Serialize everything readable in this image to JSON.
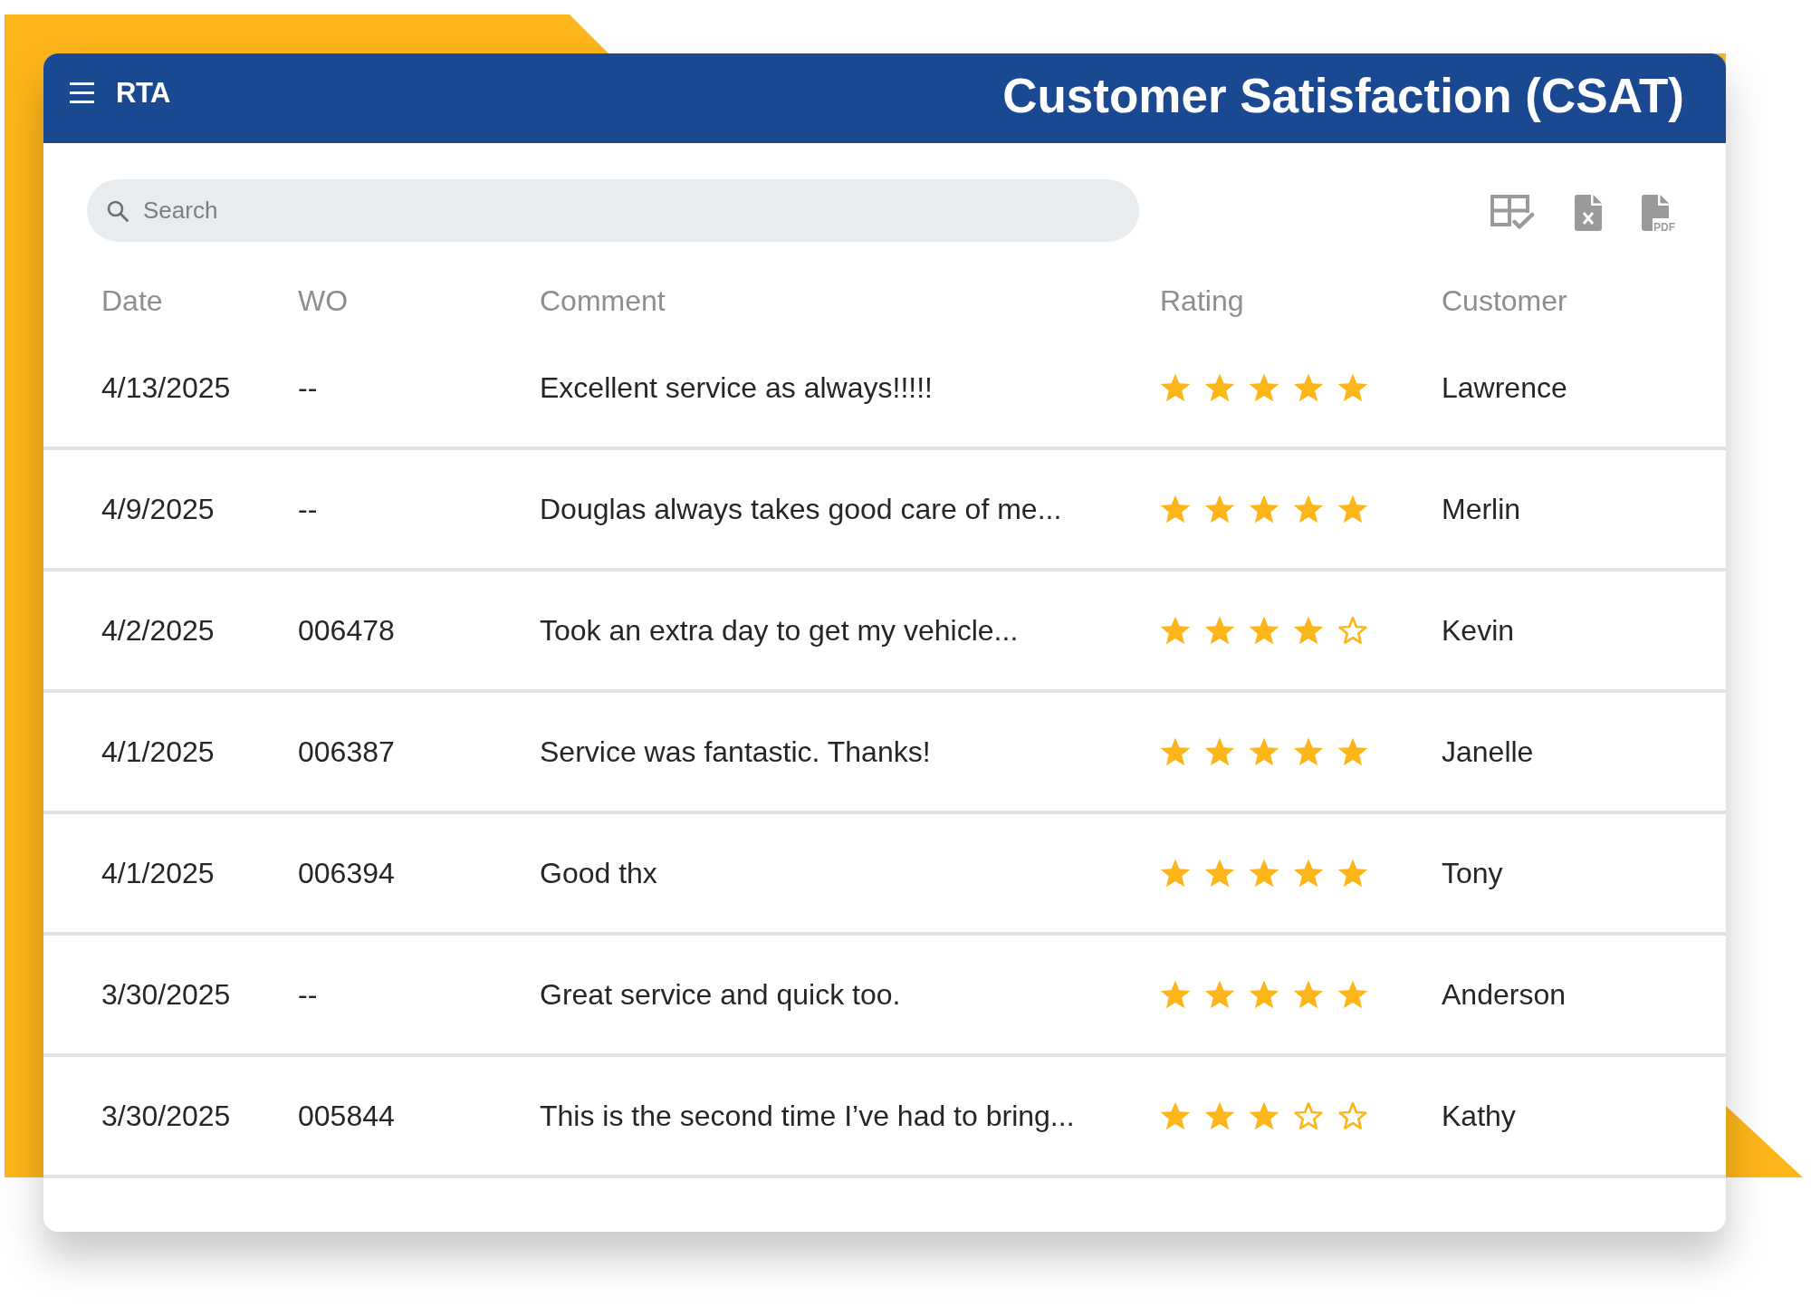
{
  "header": {
    "logo": "RTA",
    "title": "Customer Satisfaction (CSAT)"
  },
  "toolbar": {
    "search": {
      "placeholder": "Search"
    },
    "actions": [
      {
        "kind": "columns"
      },
      {
        "kind": "excel"
      },
      {
        "kind": "pdf",
        "label": "PDF"
      }
    ]
  },
  "table": {
    "columns": [
      "Date",
      "WO",
      "Comment",
      "Rating",
      "Customer"
    ],
    "rows": [
      {
        "date": "4/13/2025",
        "wo": "--",
        "comment": "Excellent service as always!!!!!",
        "stars": 5,
        "customer": "Lawrence"
      },
      {
        "date": "4/9/2025",
        "wo": "--",
        "comment": "Douglas always takes good care of me...",
        "stars": 5,
        "customer": "Merlin"
      },
      {
        "date": "4/2/2025",
        "wo": "006478",
        "comment": "Took an extra day to get my vehicle...",
        "stars": 4,
        "customer": "Kevin"
      },
      {
        "date": "4/1/2025",
        "wo": "006387",
        "comment": "Service was fantastic. Thanks!",
        "stars": 5,
        "customer": "Janelle"
      },
      {
        "date": "4/1/2025",
        "wo": "006394",
        "comment": "Good thx",
        "stars": 5,
        "customer": "Tony"
      },
      {
        "date": "3/30/2025",
        "wo": "--",
        "comment": "Great service and quick too.",
        "stars": 5,
        "customer": "Anderson"
      },
      {
        "date": "3/30/2025",
        "wo": "005844",
        "comment": "This is the second time I’ve had to bring...",
        "stars": 3,
        "customer": "Kathy"
      }
    ]
  }
}
